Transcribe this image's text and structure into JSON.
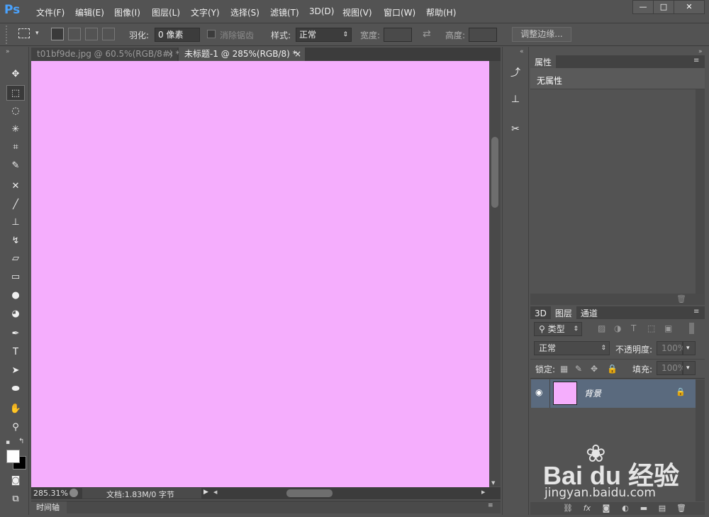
{
  "app": {
    "logo": "Ps"
  },
  "menu": [
    "文件(F)",
    "编辑(E)",
    "图像(I)",
    "图层(L)",
    "文字(Y)",
    "选择(S)",
    "滤镜(T)",
    "3D(D)",
    "视图(V)",
    "窗口(W)",
    "帮助(H)"
  ],
  "window_controls": {
    "minimize": "—",
    "maximize": "□",
    "close": "✕"
  },
  "options": {
    "feather_label": "羽化:",
    "feather_value": "0 像素",
    "antialias_label": "消除锯齿",
    "style_label": "样式:",
    "style_value": "正常",
    "width_label": "宽度:",
    "height_label": "高度:",
    "refine_edge": "调整边缘..."
  },
  "tabs": [
    {
      "label": "t01bf9de.jpg @ 60.5%(RGB/8#) *",
      "close": "×"
    },
    {
      "label": "未标题-1 @ 285%(RGB/8) *",
      "close": "×"
    }
  ],
  "status": {
    "zoom": "285.31%",
    "doc": "文档:1.83M/0 字节"
  },
  "timeline": {
    "label": "时间轴"
  },
  "properties": {
    "tab": "属性",
    "body": "无属性"
  },
  "layers": {
    "tabs": [
      "3D",
      "图层",
      "通道"
    ],
    "filter_kind": "类型",
    "blend_mode": "正常",
    "opacity_label": "不透明度:",
    "opacity_value": "100%",
    "lock_label": "锁定:",
    "fill_label": "填充:",
    "fill_value": "100%",
    "layer_name": "背景"
  },
  "colors": {
    "canvas": "#f5aefd",
    "layer_selected": "#5a6a7e",
    "ps_logo": "#4aa3ff"
  },
  "watermark": {
    "brand": "Bai du 经验",
    "url": "jingyan.baidu.com"
  }
}
